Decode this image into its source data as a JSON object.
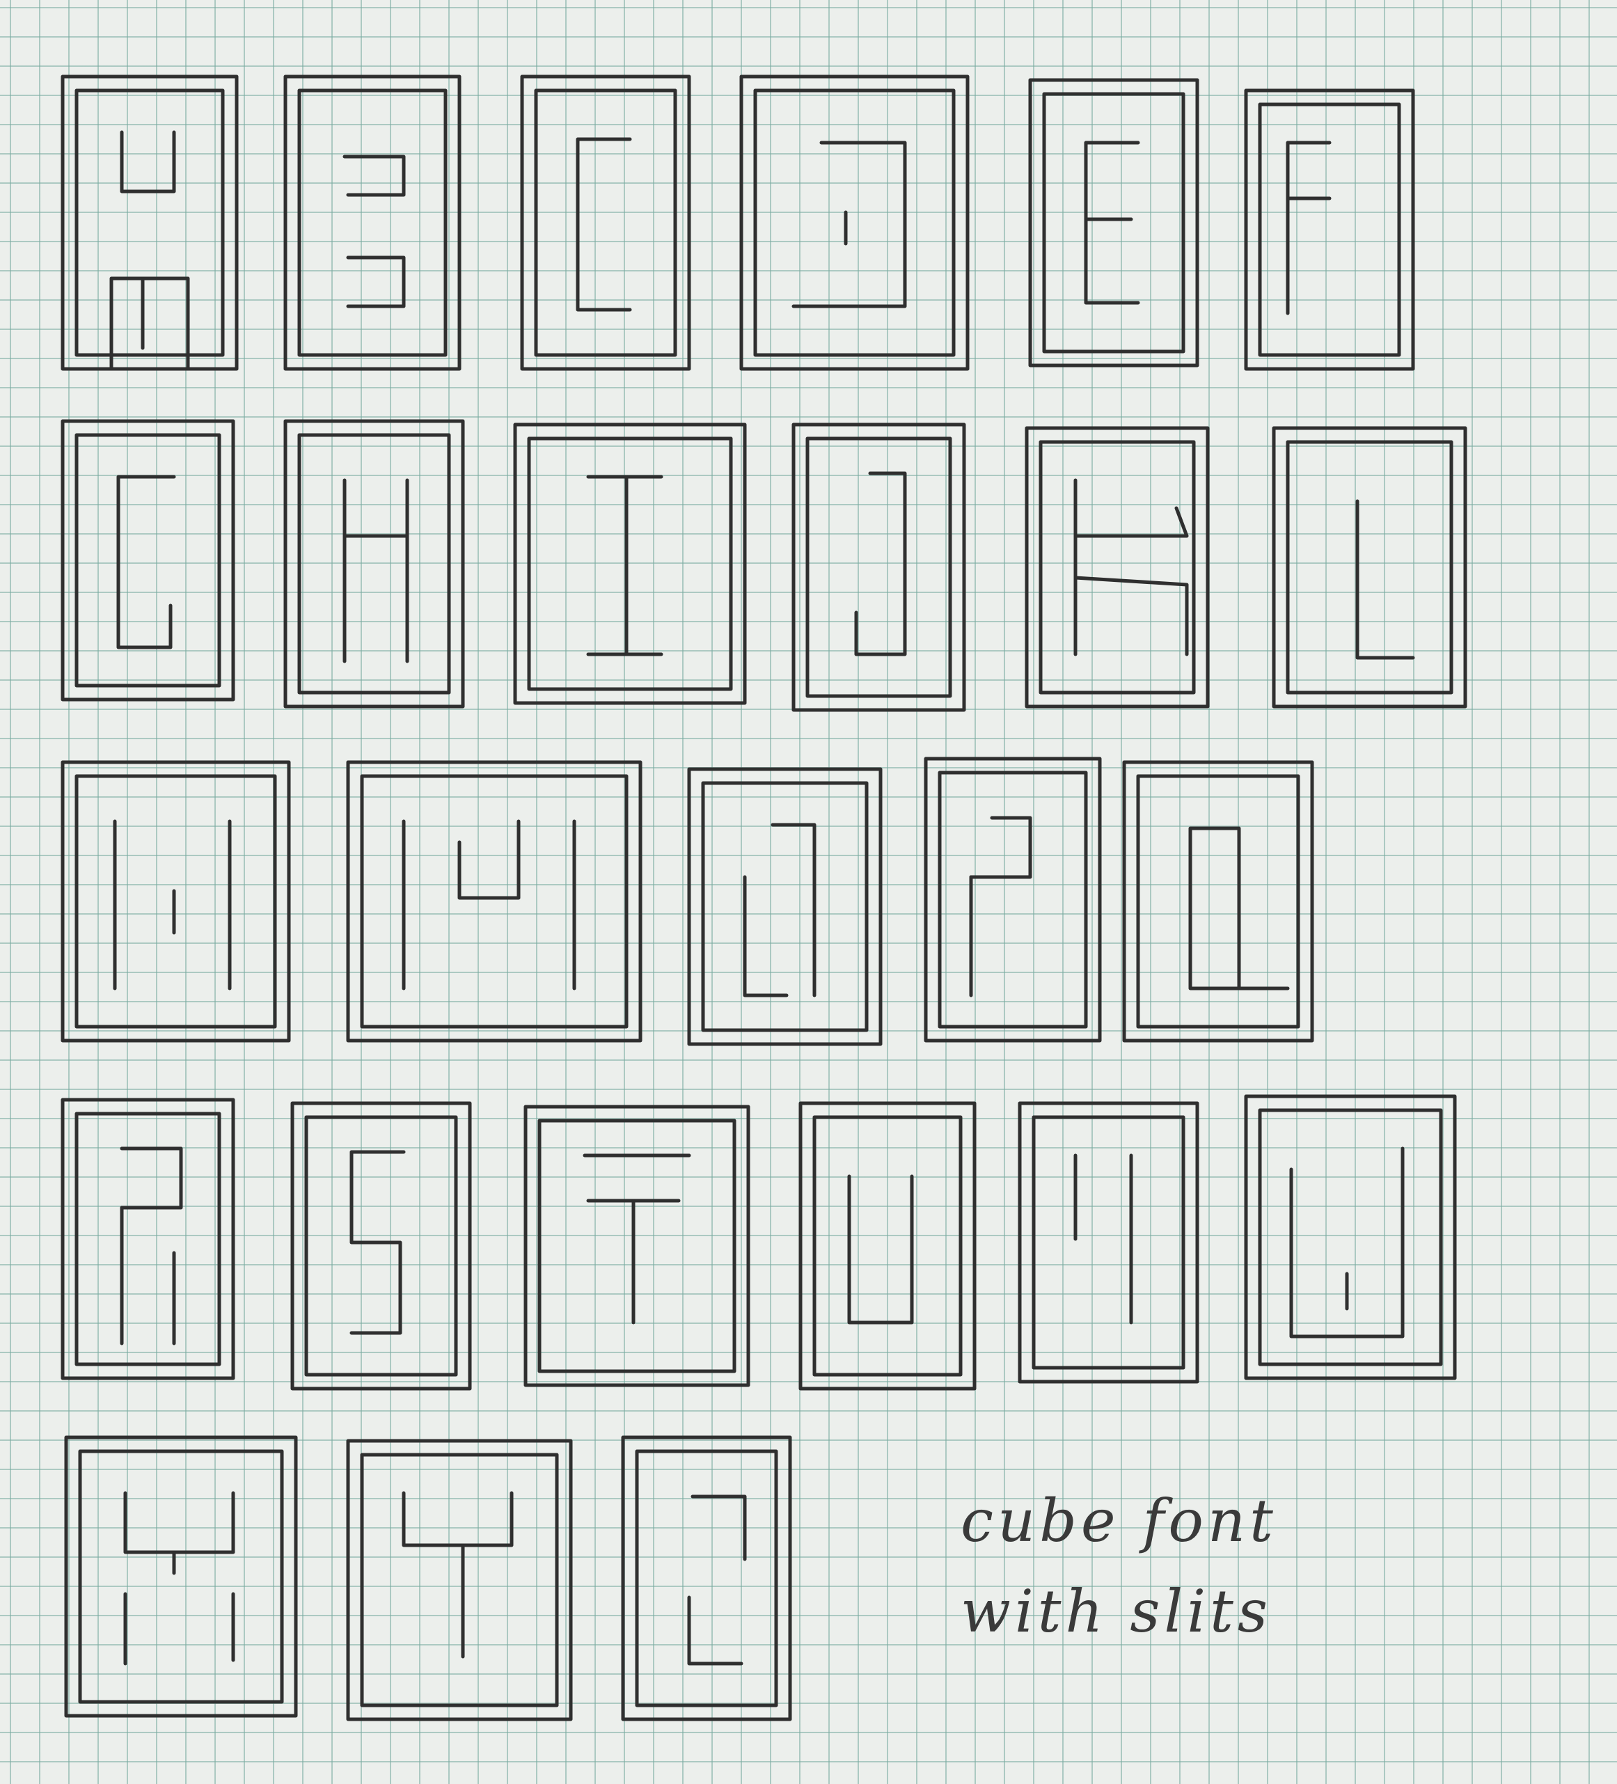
{
  "caption": {
    "line1": "cube font",
    "line2": "with slits"
  },
  "colors": {
    "paper": "#ecefec",
    "grid": "#78aaa0",
    "pencil": "#2f2f2f"
  }
}
